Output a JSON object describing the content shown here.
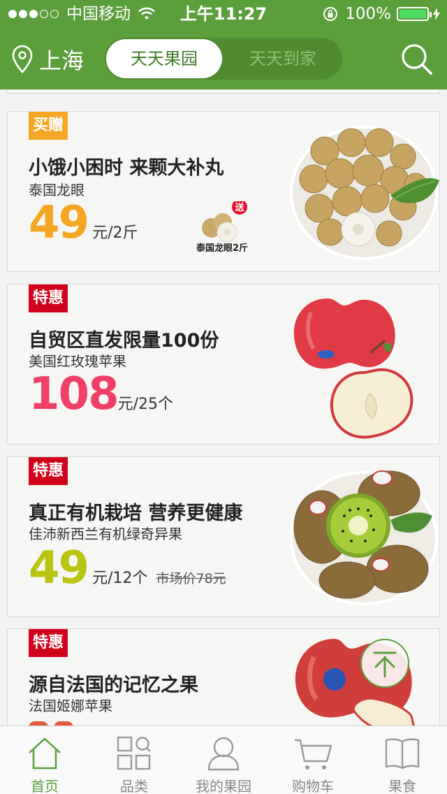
{
  "status_bar": {
    "carrier": "中国移动",
    "time": "上午11:27",
    "battery": "100%"
  },
  "header": {
    "city": "上海",
    "tabs": [
      {
        "label": "天天果园",
        "active": true
      },
      {
        "label": "天天到家",
        "active": false
      }
    ]
  },
  "products": [
    {
      "tag": "买赠",
      "title": "小饿小困时 来颗大补丸",
      "subtitle": "泰国龙眼",
      "price": "49",
      "unit": "元/2斤",
      "price_color": "#f5a623",
      "gift_badge": "送",
      "gift_label": "泰国龙眼2斤"
    },
    {
      "tag": "特惠",
      "title": "自贸区直发限量100份",
      "subtitle": "美国红玫瑰苹果",
      "price": "108",
      "unit": "元/25个",
      "price_color": "#f0406a"
    },
    {
      "tag": "特惠",
      "title": "真正有机栽培 营养更健康",
      "subtitle": "佳沛新西兰有机绿奇异果",
      "price": "49",
      "unit": "元/12个",
      "market_price": "市场价78元",
      "price_color": "#b8c40e"
    },
    {
      "tag": "特惠",
      "title": "源自法国的记忆之果",
      "subtitle": "法国姬娜苹果"
    }
  ],
  "tabbar": [
    {
      "label": "首页",
      "icon": "home-icon",
      "active": true
    },
    {
      "label": "品类",
      "icon": "category-icon",
      "active": false
    },
    {
      "label": "我的果园",
      "icon": "user-icon",
      "active": false
    },
    {
      "label": "购物车",
      "icon": "cart-icon",
      "active": false
    },
    {
      "label": "果食",
      "icon": "book-icon",
      "active": false
    }
  ],
  "colors": {
    "brand_green": "#5b9e3c",
    "tag_gift": "#f5a623",
    "tag_sale": "#d0021b"
  }
}
